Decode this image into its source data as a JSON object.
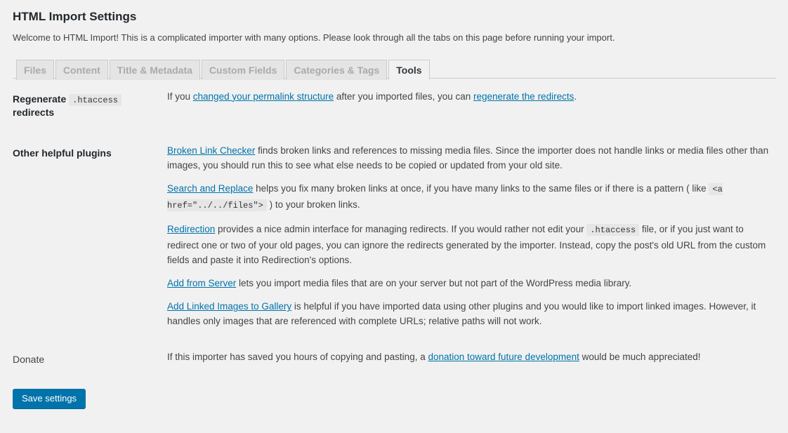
{
  "page": {
    "title": "HTML Import Settings",
    "intro": "Welcome to HTML Import! This is a complicated importer with many options. Please look through all the tabs on this page before running your import."
  },
  "tabs": [
    {
      "label": "Files",
      "active": false
    },
    {
      "label": "Content",
      "active": false
    },
    {
      "label": "Title & Metadata",
      "active": false
    },
    {
      "label": "Custom Fields",
      "active": false
    },
    {
      "label": "Categories & Tags",
      "active": false
    },
    {
      "label": "Tools",
      "active": true
    }
  ],
  "rows": {
    "regenerate": {
      "label_part1": "Regenerate",
      "label_code": ".htaccess",
      "label_part2": "redirects",
      "p1_a": "If you ",
      "p1_link1": "changed your permalink structure",
      "p1_b": " after you imported files, you can ",
      "p1_link2": "regenerate the redirects",
      "p1_c": "."
    },
    "plugins": {
      "label": "Other helpful plugins",
      "p1_link": "Broken Link Checker",
      "p1_text": " finds broken links and references to missing media files. Since the importer does not handle links or media files other than images, you should run this to see what else needs to be copied or updated from your old site.",
      "p2_link": "Search and Replace",
      "p2_a": " helps you fix many broken links at once, if you have many links to the same files or if there is a pattern ( like ",
      "p2_code": "<a href=\"../../files\">",
      "p2_b": " ) to your broken links.",
      "p3_link": "Redirection",
      "p3_a": " provides a nice admin interface for managing redirects. If you would rather not edit your ",
      "p3_code": ".htaccess",
      "p3_b": " file, or if you just want to redirect one or two of your old pages, you can ignore the redirects generated by the importer. Instead, copy the post's old URL from the custom fields and paste it into Redirection's options.",
      "p4_link": "Add from Server",
      "p4_text": " lets you import media files that are on your server but not part of the WordPress media library.",
      "p5_link": "Add Linked Images to Gallery",
      "p5_text": " is helpful if you have imported data using other plugins and you would like to import linked images. However, it handles only images that are referenced with complete URLs; relative paths will not work."
    },
    "donate": {
      "label": "Donate",
      "p1_a": "If this importer has saved you hours of copying and pasting, a ",
      "p1_link": "donation toward future development",
      "p1_b": " would be much appreciated!"
    }
  },
  "submit": {
    "save_label": "Save settings"
  },
  "colors": {
    "accent": "#0073aa",
    "background": "#f1f1f1",
    "code_background": "#e6e6e6",
    "heading": "#23282d",
    "body_text": "#444444",
    "tab_inactive_text": "#aaaaaa"
  }
}
